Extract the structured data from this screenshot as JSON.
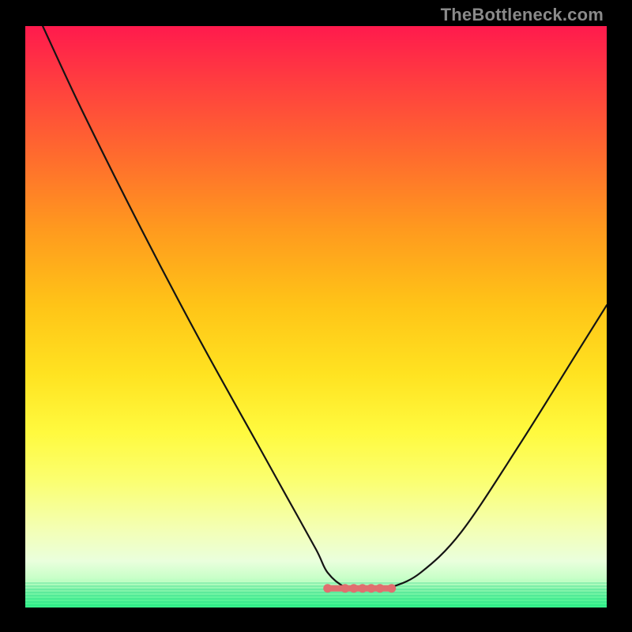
{
  "watermark": "TheBottleneck.com",
  "colors": {
    "background": "#000000",
    "curve": "#141414",
    "marker": "#e06f6f",
    "gradient_top": "#ff1a4d",
    "gradient_bottom": "#34f58a"
  },
  "chart_data": {
    "type": "line",
    "title": "",
    "xlabel": "",
    "ylabel": "",
    "xlim": [
      0,
      100
    ],
    "ylim": [
      0,
      100
    ],
    "series": [
      {
        "name": "bottleneck-curve",
        "x": [
          3,
          10,
          20,
          30,
          40,
          45,
          50,
          52,
          55,
          58,
          60,
          63,
          68,
          75,
          85,
          95,
          100
        ],
        "y": [
          100,
          85,
          65,
          46,
          28,
          19,
          10,
          6,
          3.5,
          3,
          3,
          3.5,
          6,
          13,
          28,
          44,
          52
        ]
      }
    ],
    "markers": {
      "flat_region_x": [
        52,
        63
      ],
      "flat_region_y": 3.3,
      "dots_x": [
        52,
        55,
        56.5,
        58,
        59.5,
        61,
        63
      ]
    }
  }
}
